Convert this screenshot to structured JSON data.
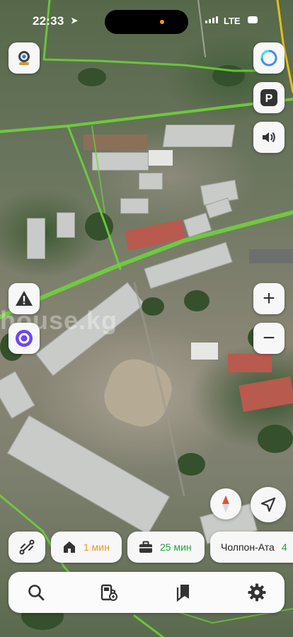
{
  "status_bar": {
    "time": "22:33",
    "network": "LTE"
  },
  "map": {
    "type": "satellite",
    "watermark": "house.kg",
    "route_color": "#7ddc3c"
  },
  "controls": {
    "alice_color": "#6b45f2",
    "compass_color": "#e2503b",
    "zoom_in": "+",
    "zoom_out": "−"
  },
  "shortcuts": [
    {
      "icon": "home-icon",
      "value": "1 мин",
      "color": "#e79a17"
    },
    {
      "icon": "briefcase-icon",
      "value": "25 мин",
      "color": "#21a337"
    },
    {
      "icon": "",
      "value": "Чолпон-Ата",
      "extra": "4",
      "extra_color": "#21a337"
    }
  ],
  "bottom_nav": [
    "search-icon",
    "gas-station-icon",
    "bookmarks-icon",
    "settings-icon"
  ]
}
